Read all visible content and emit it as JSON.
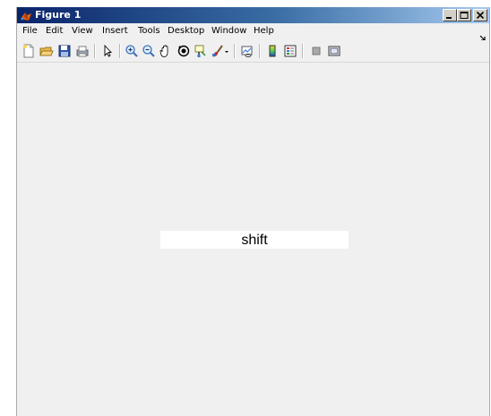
{
  "window": {
    "title": "Figure 1",
    "title_gradient": [
      "#0a246a",
      "#a6caf0"
    ],
    "app_icon": "matlab-logo-icon"
  },
  "menubar": {
    "items": [
      {
        "label": "File"
      },
      {
        "label": "Edit"
      },
      {
        "label": "View"
      },
      {
        "label": "Insert"
      },
      {
        "label": "Tools"
      },
      {
        "label": "Desktop"
      },
      {
        "label": "Window"
      },
      {
        "label": "Help"
      }
    ],
    "dock_icon": "dock-arrow-icon"
  },
  "toolbar": {
    "icons": [
      "new-figure-icon",
      "open-file-icon",
      "save-icon",
      "print-icon",
      "pointer-icon",
      "zoom-in-icon",
      "zoom-out-icon",
      "pan-icon",
      "rotate-3d-icon",
      "data-cursor-icon",
      "brush-icon",
      "brush-dropdown-icon",
      "link-plot-icon",
      "colorbar-icon",
      "legend-icon",
      "hide-plot-tools-icon",
      "show-plot-tools-icon"
    ]
  },
  "figure": {
    "text_label": "shift",
    "background": "#f0f0f0",
    "label_background": "#ffffff"
  }
}
